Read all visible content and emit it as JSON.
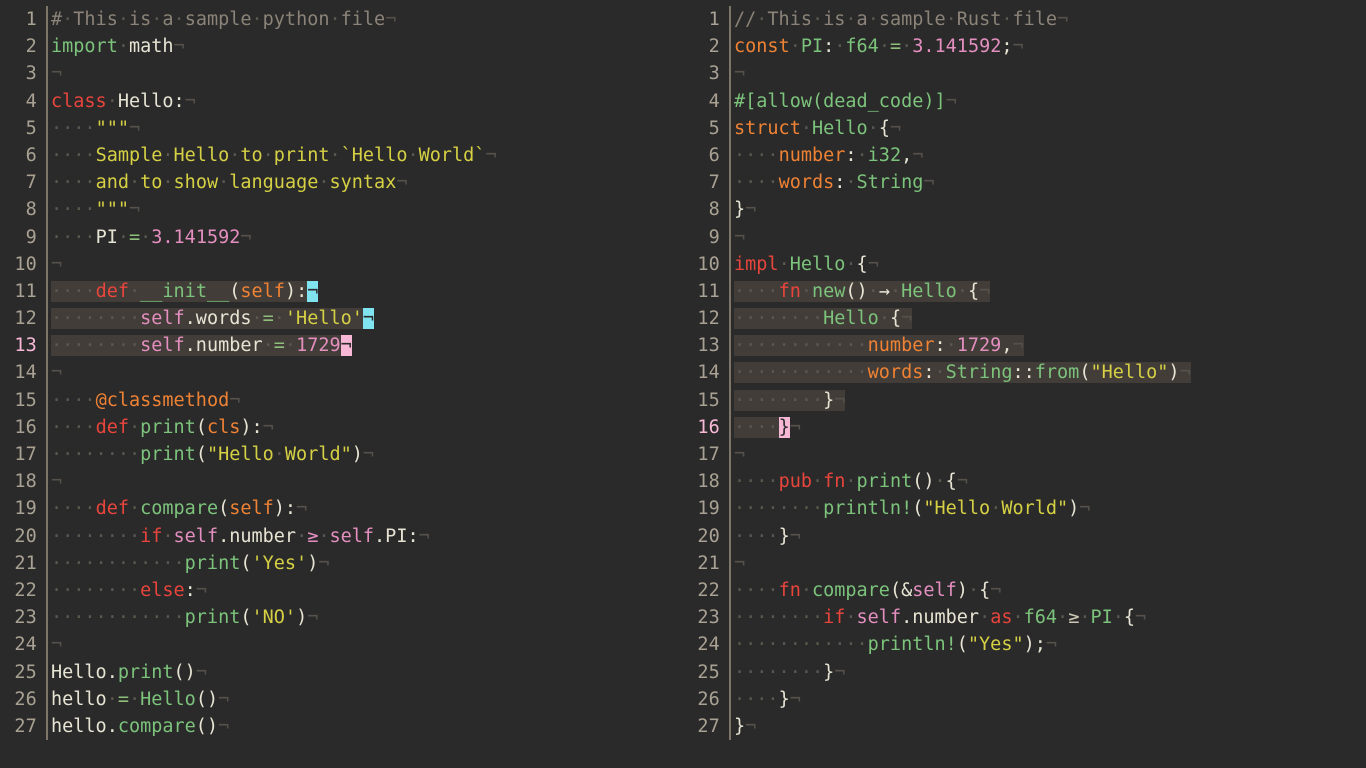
{
  "editor": {
    "theme_background": "#2a2a2a",
    "selection_color": "#423d38",
    "gutter_color": "#a9a193",
    "cursor_line_gutter_color": "#f8b8d8",
    "cursor_colors": {
      "secondary": "#7fe3f0",
      "primary": "#f7b8d6"
    },
    "separator_color": "#7d7567",
    "whitespace_dot": "·",
    "eol_marker": "¬"
  },
  "panes": [
    {
      "name": "python-pane",
      "language": "Python",
      "cursor_line": 13,
      "line_count": 27,
      "lines": [
        {
          "n": 1,
          "text": "# This is a sample python file"
        },
        {
          "n": 2,
          "text": "import math"
        },
        {
          "n": 3,
          "text": ""
        },
        {
          "n": 4,
          "text": "class Hello:"
        },
        {
          "n": 5,
          "text": "    \"\"\""
        },
        {
          "n": 6,
          "text": "    Sample Hello to print `Hello World`"
        },
        {
          "n": 7,
          "text": "    and to show language syntax"
        },
        {
          "n": 8,
          "text": "    \"\"\""
        },
        {
          "n": 9,
          "text": "    PI = 3.141592"
        },
        {
          "n": 10,
          "text": ""
        },
        {
          "n": 11,
          "text": "    def __init__(self):"
        },
        {
          "n": 12,
          "text": "        self.words = 'Hello'"
        },
        {
          "n": 13,
          "text": "        self.number = 1729"
        },
        {
          "n": 14,
          "text": ""
        },
        {
          "n": 15,
          "text": "    @classmethod"
        },
        {
          "n": 16,
          "text": "    def print(cls):"
        },
        {
          "n": 17,
          "text": "        print(\"Hello World\")"
        },
        {
          "n": 18,
          "text": ""
        },
        {
          "n": 19,
          "text": "    def compare(self):"
        },
        {
          "n": 20,
          "text": "        if self.number >= self.PI:"
        },
        {
          "n": 21,
          "text": "            print('Yes')"
        },
        {
          "n": 22,
          "text": "        else:"
        },
        {
          "n": 23,
          "text": "            print('NO')"
        },
        {
          "n": 24,
          "text": ""
        },
        {
          "n": 25,
          "text": "Hello.print()"
        },
        {
          "n": 26,
          "text": "hello = Hello()"
        },
        {
          "n": 27,
          "text": "hello.compare()"
        }
      ],
      "selected_lines": [
        11,
        12,
        13
      ],
      "cursors": [
        {
          "line": 11,
          "column": 24,
          "color": "secondary"
        },
        {
          "line": 12,
          "column": 29,
          "color": "secondary"
        },
        {
          "line": 13,
          "column": 27,
          "color": "primary"
        }
      ]
    },
    {
      "name": "rust-pane",
      "language": "Rust",
      "cursor_line": 16,
      "line_count": 27,
      "lines": [
        {
          "n": 1,
          "text": "// This is a sample Rust file"
        },
        {
          "n": 2,
          "text": "const PI: f64 = 3.141592;"
        },
        {
          "n": 3,
          "text": ""
        },
        {
          "n": 4,
          "text": "#[allow(dead_code)]"
        },
        {
          "n": 5,
          "text": "struct Hello {"
        },
        {
          "n": 6,
          "text": "    number: i32,"
        },
        {
          "n": 7,
          "text": "    words: String"
        },
        {
          "n": 8,
          "text": "}"
        },
        {
          "n": 9,
          "text": ""
        },
        {
          "n": 10,
          "text": "impl Hello {"
        },
        {
          "n": 11,
          "text": "    fn new() -> Hello {"
        },
        {
          "n": 12,
          "text": "        Hello {"
        },
        {
          "n": 13,
          "text": "            number: 1729,"
        },
        {
          "n": 14,
          "text": "            words: String::from(\"Hello\")"
        },
        {
          "n": 15,
          "text": "        }"
        },
        {
          "n": 16,
          "text": "    }"
        },
        {
          "n": 17,
          "text": ""
        },
        {
          "n": 18,
          "text": "    pub fn print() {"
        },
        {
          "n": 19,
          "text": "        println!(\"Hello World\")"
        },
        {
          "n": 20,
          "text": "    }"
        },
        {
          "n": 21,
          "text": ""
        },
        {
          "n": 22,
          "text": "    fn compare(&self) {"
        },
        {
          "n": 23,
          "text": "        if self.number as f64 >= PI {"
        },
        {
          "n": 24,
          "text": "            println!(\"Yes\");"
        },
        {
          "n": 25,
          "text": "        }"
        },
        {
          "n": 26,
          "text": "    }"
        },
        {
          "n": 27,
          "text": "}"
        }
      ],
      "selected_lines": [
        11,
        12,
        13,
        14,
        15,
        16
      ],
      "cursors": [
        {
          "line": 16,
          "column": 5,
          "color": "primary"
        }
      ]
    }
  ]
}
